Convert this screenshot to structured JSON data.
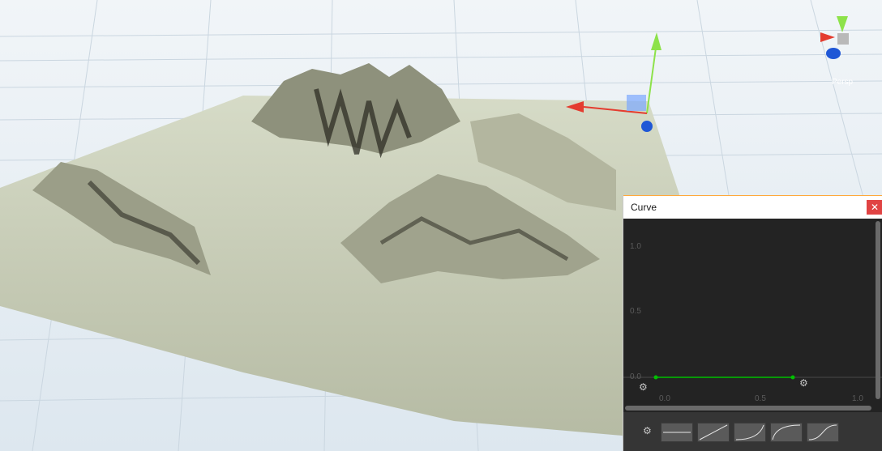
{
  "view": {
    "persp_label": "Persp",
    "gizmo_icon": "scene-orientation-gizmo-icon",
    "move_tool_icon": "move-tool-gizmo-icon"
  },
  "curve_window": {
    "title": "Curve",
    "close_icon": "close-icon",
    "y_ticks": [
      "1.0",
      "0.5",
      "0.0"
    ],
    "x_ticks": [
      "0.0",
      "0.5",
      "1.0"
    ],
    "curve_color": "#00c000",
    "preset_icons": [
      "linear-preset-icon",
      "ease-in-preset-icon",
      "ease-out-preset-icon",
      "ease-out-strong-preset-icon",
      "ease-in-out-preset-icon"
    ],
    "settings_icon": "gear-icon"
  }
}
